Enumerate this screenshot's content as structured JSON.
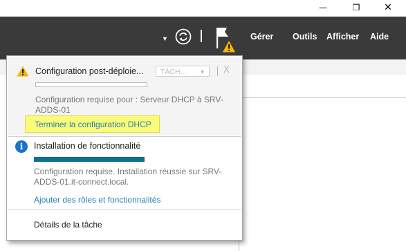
{
  "window": {
    "minimize_glyph": "—",
    "maximize_glyph": "❐",
    "close_glyph": "✕"
  },
  "toolbar": {
    "dropdown_glyph": "▼",
    "menu": [
      "Gérer",
      "Outils",
      "Afficher",
      "Aide"
    ],
    "icons": [
      "refresh-icon",
      "notification-flag-icon",
      "warning-badge-icon"
    ]
  },
  "notifications": [
    {
      "icon": "warning-icon",
      "title": "Configuration post-déploie...",
      "task_button": "TÂCH...",
      "close": "X",
      "progress": 0,
      "description": "Configuration requise pour : Serveur DHCP à SRV-ADDS-01",
      "link": "Terminer la configuration DHCP"
    },
    {
      "icon": "info-icon",
      "title": "Installation de fonctionnalité",
      "progress": 1.0,
      "description": "Configuration requise. Installation réussie sur SRV-ADDS-01.it-connect.local.",
      "link": "Ajouter des rôles et fonctionnalités"
    }
  ],
  "footer": {
    "details_label": "Détails de la tâche"
  },
  "colors": {
    "toolbar_bg": "#3a3a3a",
    "link": "#2a7fb5",
    "highlight": "#fbfb7a",
    "progress": "#0f6f93",
    "warning": "#f2b705",
    "info": "#1a73c7"
  }
}
